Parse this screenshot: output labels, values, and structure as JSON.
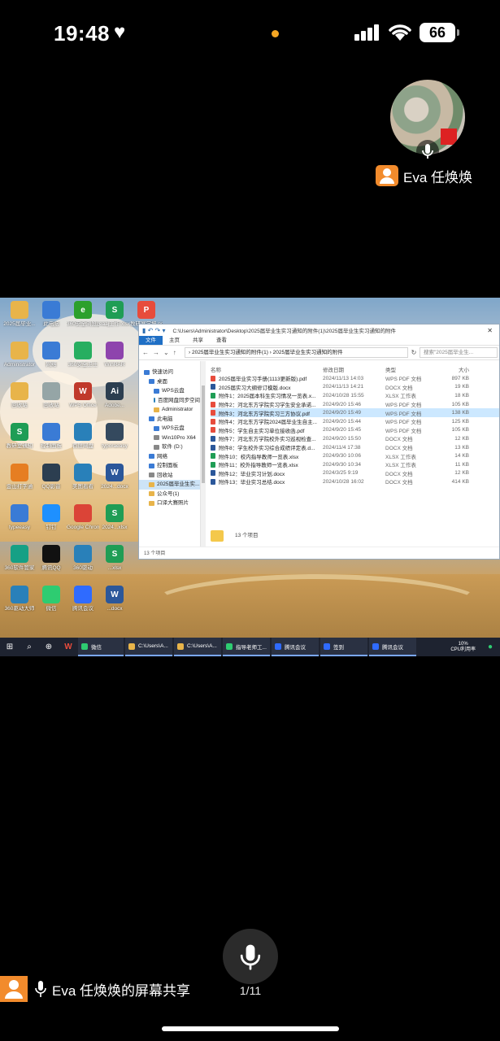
{
  "status_bar": {
    "time": "19:48",
    "heart": "♥",
    "battery": "66",
    "dot_color": "#f5a623"
  },
  "participant": {
    "name": "Eva 任焕焕",
    "badge_color": "#f28b2c"
  },
  "shared_screen": {
    "desktop_icons": [
      {
        "label": "2025届毕业...",
        "color": "#e8b44a",
        "glyph": ""
      },
      {
        "label": "此电脑",
        "color": "#3a7bd5",
        "glyph": ""
      },
      {
        "label": "360安全浏览器",
        "color": "#2ca02c",
        "glyph": "e"
      },
      {
        "label": "eaaj工作.xlsx",
        "color": "#1f9d55",
        "glyph": "S"
      },
      {
        "label": "教研室学报.pdf",
        "color": "#e74c3c",
        "glyph": "P"
      },
      {
        "label": "Administrator",
        "color": "#e8b44a",
        "glyph": ""
      },
      {
        "label": "网络",
        "color": "#3a7bd5",
        "glyph": ""
      },
      {
        "label": "360安全卫士",
        "color": "#27ae60",
        "glyph": ""
      },
      {
        "label": "WinRAR",
        "color": "#8e44ad",
        "glyph": ""
      },
      {
        "label": "回收站",
        "color": "#e8b44a",
        "glyph": ""
      },
      {
        "label": "回收站",
        "color": "#95a5a6",
        "glyph": ""
      },
      {
        "label": "WPS Office",
        "color": "#c0392b",
        "glyph": "W"
      },
      {
        "label": "Adobe...",
        "color": "#2c3e50",
        "glyph": "Ai"
      },
      {
        "label": "教研室通知",
        "color": "#1f9d55",
        "glyph": "S"
      },
      {
        "label": "控制面板",
        "color": "#3a7bd5",
        "glyph": ""
      },
      {
        "label": "百度网盘",
        "color": "#2980b9",
        "glyph": ""
      },
      {
        "label": "typoraeasy",
        "color": "#34495e",
        "glyph": ""
      },
      {
        "label": "金山打字通",
        "color": "#e67e22",
        "glyph": ""
      },
      {
        "label": "QQ影音",
        "color": "#2c3e50",
        "glyph": ""
      },
      {
        "label": "美图看看",
        "color": "#2980b9",
        "glyph": ""
      },
      {
        "label": "2024...docx",
        "color": "#2b579a",
        "glyph": "W"
      },
      {
        "label": "typeeasy",
        "color": "#3a7bd5",
        "glyph": ""
      },
      {
        "label": "钉钉",
        "color": "#1e90ff",
        "glyph": ""
      },
      {
        "label": "Google Chrome",
        "color": "#db4437",
        "glyph": ""
      },
      {
        "label": "2024...xlsx",
        "color": "#1f9d55",
        "glyph": "S"
      },
      {
        "label": "360软件管家",
        "color": "#16a085",
        "glyph": ""
      },
      {
        "label": "腾讯QQ",
        "color": "#111111",
        "glyph": ""
      },
      {
        "label": "360驱动",
        "color": "#2980b9",
        "glyph": ""
      },
      {
        "label": "...xlsx",
        "color": "#1f9d55",
        "glyph": "S"
      },
      {
        "label": "360驱动大师",
        "color": "#2980b9",
        "glyph": ""
      },
      {
        "label": "微信",
        "color": "#2ecc71",
        "glyph": ""
      },
      {
        "label": "腾讯会议",
        "color": "#2f6bff",
        "glyph": ""
      },
      {
        "label": "...docx",
        "color": "#2b579a",
        "glyph": "W"
      }
    ],
    "explorer": {
      "title_path": "C:\\Users\\Administrator\\Desktop\\2025届毕业生实习通知的附件(1)\\2025届毕业生实习通知的附件",
      "ribbon_tabs": [
        "文件",
        "主页",
        "共享",
        "查看"
      ],
      "breadcrumb": "› 2025届毕业生实习通知的附件(1) › 2025届毕业生实习通知的附件",
      "search_placeholder": "搜索\"2025届毕业生...",
      "nav_items": [
        {
          "label": "快速访问",
          "color": "#3a7bd5"
        },
        {
          "label": "桌面",
          "color": "#3a7bd5"
        },
        {
          "label": "WPS云盘",
          "color": "#3a7bd5"
        },
        {
          "label": "百度网盘同步空间",
          "color": "#2980b9"
        },
        {
          "label": "Administrator",
          "color": "#e8b44a"
        },
        {
          "label": "此电脑",
          "color": "#3a7bd5"
        },
        {
          "label": "WPS云盘",
          "color": "#3a7bd5"
        },
        {
          "label": "Win10Pro X64",
          "color": "#888888"
        },
        {
          "label": "软件 (D:)",
          "color": "#888888"
        },
        {
          "label": "网络",
          "color": "#3a7bd5"
        },
        {
          "label": "控制面板",
          "color": "#3a7bd5"
        },
        {
          "label": "回收站",
          "color": "#888888"
        },
        {
          "label": "2025届毕业生实...",
          "color": "#e8b44a"
        },
        {
          "label": "公众号(1)",
          "color": "#e8b44a"
        },
        {
          "label": "口译大赛照片",
          "color": "#e8b44a"
        }
      ],
      "columns": [
        "名称",
        "修改日期",
        "类型",
        "大小"
      ],
      "files": [
        {
          "name": "2025届毕业实习手册(1113更新版).pdf",
          "date": "2024/11/13 14:03",
          "type": "WPS PDF 文档",
          "size": "897 KB",
          "color": "#e74c3c"
        },
        {
          "name": "2025届实习大纲修订模版.docx",
          "date": "2024/11/13 14:21",
          "type": "DOCX 文档",
          "size": "19 KB",
          "color": "#2b579a"
        },
        {
          "name": "附件1：2025届本科生实习情况一览表.x...",
          "date": "2024/10/28 15:55",
          "type": "XLSX 工作表",
          "size": "18 KB",
          "color": "#1f9d55"
        },
        {
          "name": "附件2：河北东方学院实习学生安全承诺...",
          "date": "2024/9/20 15:46",
          "type": "WPS PDF 文档",
          "size": "105 KB",
          "color": "#e74c3c"
        },
        {
          "name": "附件3：河北东方学院实习三方协议.pdf",
          "date": "2024/9/20 15:49",
          "type": "WPS PDF 文档",
          "size": "138 KB",
          "color": "#e74c3c"
        },
        {
          "name": "附件4：河北东方学院2024届毕业生自主...",
          "date": "2024/9/20 15:44",
          "type": "WPS PDF 文档",
          "size": "125 KB",
          "color": "#e74c3c"
        },
        {
          "name": "附件5：学生自主实习单位接收函.pdf",
          "date": "2024/9/20 15:45",
          "type": "WPS PDF 文档",
          "size": "105 KB",
          "color": "#e74c3c"
        },
        {
          "name": "附件7：河北东方学院校外实习巡视检查...",
          "date": "2024/9/20 15:50",
          "type": "DOCX 文档",
          "size": "12 KB",
          "color": "#2b579a"
        },
        {
          "name": "附件8：学生校外实习综合成绩评定表.d...",
          "date": "2024/11/4 17:38",
          "type": "DOCX 文档",
          "size": "13 KB",
          "color": "#2b579a"
        },
        {
          "name": "附件10：校内指导教师一览表.xlsx",
          "date": "2024/9/30 10:06",
          "type": "XLSX 工作表",
          "size": "14 KB",
          "color": "#1f9d55"
        },
        {
          "name": "附件11：校外指导教师一览表.xlsx",
          "date": "2024/9/30 10:34",
          "type": "XLSX 工作表",
          "size": "11 KB",
          "color": "#1f9d55"
        },
        {
          "name": "附件12：毕业实习计划.docx",
          "date": "2024/3/25 9:19",
          "type": "DOCX 文档",
          "size": "12 KB",
          "color": "#2b579a"
        },
        {
          "name": "附件13：毕业实习总结.docx",
          "date": "2024/10/28 16:02",
          "type": "DOCX 文档",
          "size": "414 KB",
          "color": "#2b579a"
        }
      ],
      "selected_row": 4,
      "inline_count": "13 个项目",
      "status_count": "13 个项目"
    },
    "taskbar": {
      "apps": [
        {
          "label": "微信",
          "color": "#2ecc71"
        },
        {
          "label": "C:\\Users\\A...",
          "color": "#e8b44a"
        },
        {
          "label": "C:\\Users\\A...",
          "color": "#e8b44a"
        },
        {
          "label": "指导老师工...",
          "color": "#2ecc71"
        },
        {
          "label": "腾讯会议",
          "color": "#2f6bff"
        },
        {
          "label": "签到",
          "color": "#2f6bff"
        },
        {
          "label": "腾讯会议",
          "color": "#2f6bff"
        }
      ],
      "cpu_percent": "10%",
      "cpu_label": "CPU利用率"
    }
  },
  "controls": {
    "page_indicator": "1/11",
    "share_label": "Eva 任焕焕的屏幕共享"
  }
}
